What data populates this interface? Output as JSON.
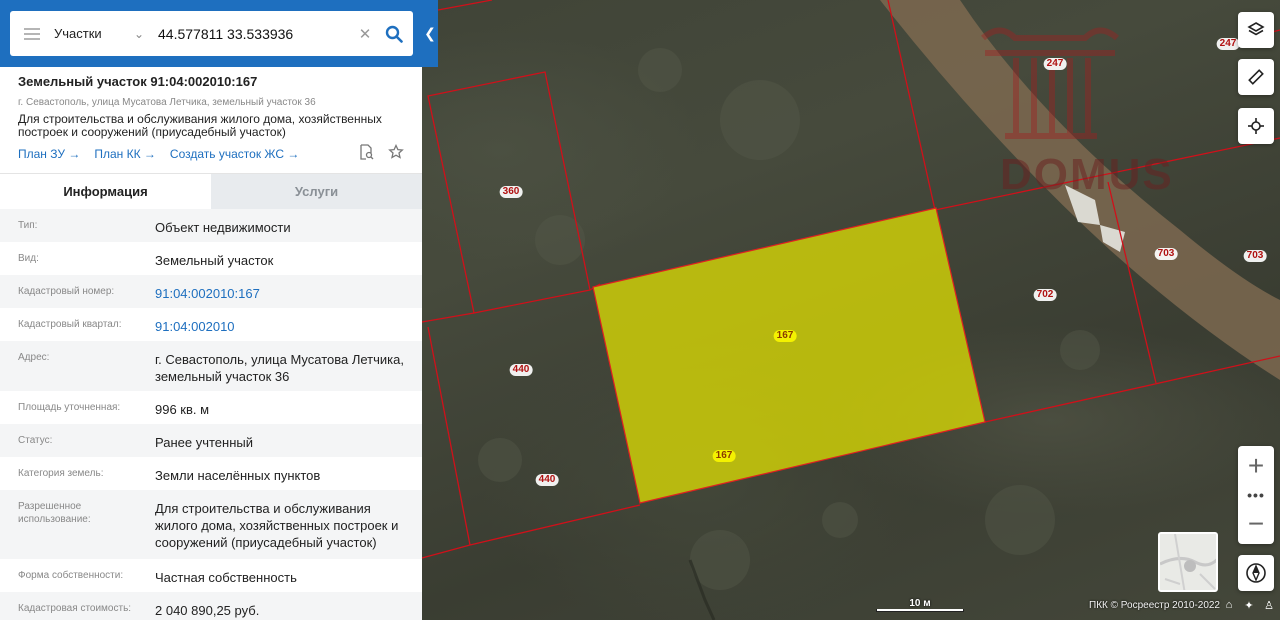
{
  "search": {
    "category": "Участки",
    "query": "44.577811 33.533936"
  },
  "parcel": {
    "title": "Земельный участок 91:04:002010:167",
    "address_short": "г. Севастополь, улица Мусатова Летчика, земельный участок 36",
    "description": "Для строительства и обслуживания жилого дома, хозяйственных построек и сооружений (приусадебный участок)",
    "links": [
      "План ЗУ →",
      "План КК →",
      "Создать участок ЖС →"
    ]
  },
  "tabs": [
    "Информация",
    "Услуги"
  ],
  "info": [
    {
      "key": "Тип:",
      "value": "Объект недвижимости",
      "link": false
    },
    {
      "key": "Вид:",
      "value": "Земельный участок",
      "link": false
    },
    {
      "key": "Кадастровый номер:",
      "value": "91:04:002010:167",
      "link": true
    },
    {
      "key": "Кадастровый квартал:",
      "value": "91:04:002010",
      "link": true
    },
    {
      "key": "Адрес:",
      "value": "г. Севастополь, улица Мусатова Летчика, земельный участок 36",
      "link": false
    },
    {
      "key": "Площадь уточненная:",
      "value": "996 кв. м",
      "link": false
    },
    {
      "key": "Статус:",
      "value": "Ранее учтенный",
      "link": false
    },
    {
      "key": "Категория земель:",
      "value": "Земли населённых пунктов",
      "link": false
    },
    {
      "key": "Разрешенное использование:",
      "value": "Для строительства и обслуживания жилого дома, хозяйственных построек и сооружений (приусадебный участок)",
      "link": false
    },
    {
      "key": "Форма собственности:",
      "value": "Частная собственность",
      "link": false
    },
    {
      "key": "Кадастровая стоимость:",
      "value": "2 040 890,25 руб.",
      "link": false
    }
  ],
  "map": {
    "parcel_labels": [
      "360",
      "167",
      "167",
      "440",
      "440",
      "702",
      "703",
      "703",
      "247",
      "247"
    ],
    "watermark": "DOMUS",
    "scale_label": "10 м",
    "copyright": "ПКК © Росреестр 2010-2022",
    "zoom_in": "+",
    "zoom_out": "−",
    "zoom_more": "•••"
  },
  "icons": {
    "menu": "hamburger-icon",
    "search": "magnifier-icon",
    "clear": "close-icon",
    "collapse": "chevron-left-icon",
    "layers": "layers-icon",
    "ruler": "ruler-icon",
    "locate": "crosshair-icon",
    "compass": "compass-icon"
  },
  "colors": {
    "brand": "#1e6fbf",
    "selected_parcel": "#e6e600",
    "boundary": "#d0101a"
  }
}
